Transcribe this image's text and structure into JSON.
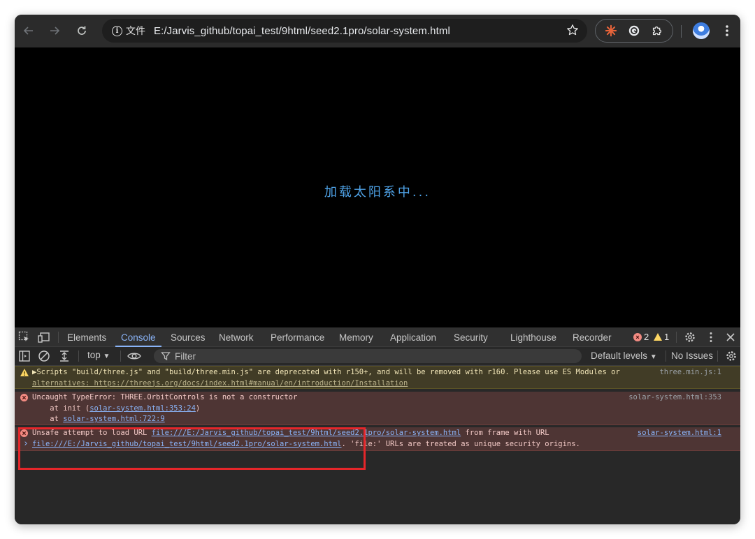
{
  "browser": {
    "site_chip": "文件",
    "url": "E:/Jarvis_github/topai_test/9html/seed2.1pro/solar-system.html"
  },
  "page": {
    "loading_text": "加载太阳系中..."
  },
  "devtools": {
    "tabs": [
      "Elements",
      "Console",
      "Sources",
      "Network",
      "Performance",
      "Memory",
      "Application",
      "Security",
      "Lighthouse",
      "Recorder"
    ],
    "active_tab": "Console",
    "error_count": "2",
    "warning_count": "1",
    "context": "top",
    "filter_placeholder": "Filter",
    "levels": "Default levels",
    "issues": "No Issues"
  },
  "console": {
    "warning": {
      "text": "▶Scripts \"build/three.js\" and \"build/three.min.js\" are deprecated with r150+, and will be removed with r160. Please use ES Modules or",
      "line2": "alternatives: https://threejs.org/docs/index.html#manual/en/introduction/Installation",
      "source": "three.min.js:1"
    },
    "error1": {
      "text": "Uncaught TypeError: THREE.OrbitControls is not a constructor",
      "at_init_prefix": "    at init (",
      "at_init_link": "solar-system.html:353:24",
      "at_init_suffix": ")",
      "at2_prefix": "    at ",
      "at2_link": "solar-system.html:722:9",
      "source": "solar-system.html:353"
    },
    "error2": {
      "prefix": "Unsafe attempt to load URL ",
      "link1": "file:///E:/Jarvis_github/topai_test/9html/seed2.1pro/solar-system.html",
      "middle": " from frame with URL",
      "link2": "file:///E:/Jarvis_github/topai_test/9html/seed2.1pro/solar-system.html",
      "suffix": ". 'file:' URLs are treated as unique security origins.",
      "source": "solar-system.html:1"
    },
    "prompt_symbol": "›"
  },
  "colors": {
    "loading_text": "#4fa3e8",
    "accent": "#8ab4f8",
    "error": "#f28b82",
    "warning": "#fdd663",
    "highlight_box": "#e5262a"
  }
}
